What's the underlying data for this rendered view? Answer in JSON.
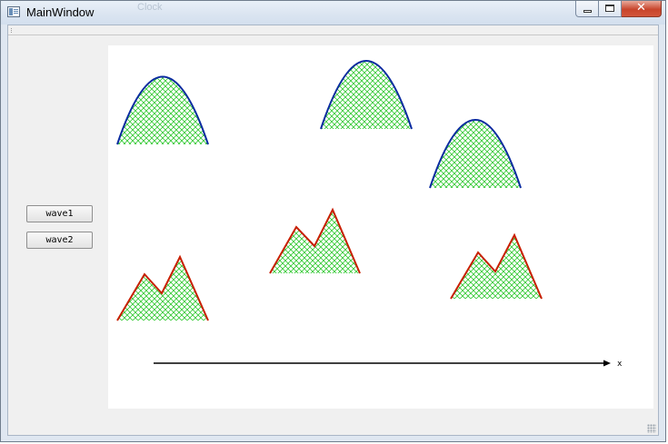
{
  "window": {
    "title": "MainWindow",
    "background_ghost_text": "Clock",
    "close_glyph": "✕"
  },
  "buttons": {
    "wave1": "wave1",
    "wave2": "wave2"
  },
  "plot": {
    "axis_label": "x",
    "fill_color": "#32c832",
    "arch_color": "#0a2aa0",
    "peak_color": "#c81e00"
  }
}
